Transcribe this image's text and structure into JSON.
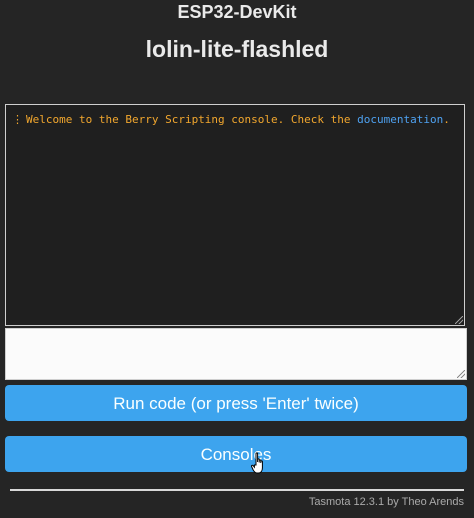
{
  "header": {
    "device_name": "ESP32-DevKit",
    "page_title": "lolin-lite-flashled"
  },
  "console": {
    "welcome_prefix": "Welcome to the Berry Scripting console. Check the ",
    "welcome_link": "documentation",
    "welcome_suffix": ".",
    "input_value": "",
    "text_color": "#f2a72e",
    "link_color": "#4ea1f0"
  },
  "buttons": {
    "run_label": "Run code (or press 'Enter' twice)",
    "consoles_label": "Consoles",
    "color": "#3da4ee"
  },
  "footer": {
    "text": "Tasmota 12.3.1 by Theo Arends"
  },
  "cursor": {
    "icon": "hand-pointer-icon"
  }
}
